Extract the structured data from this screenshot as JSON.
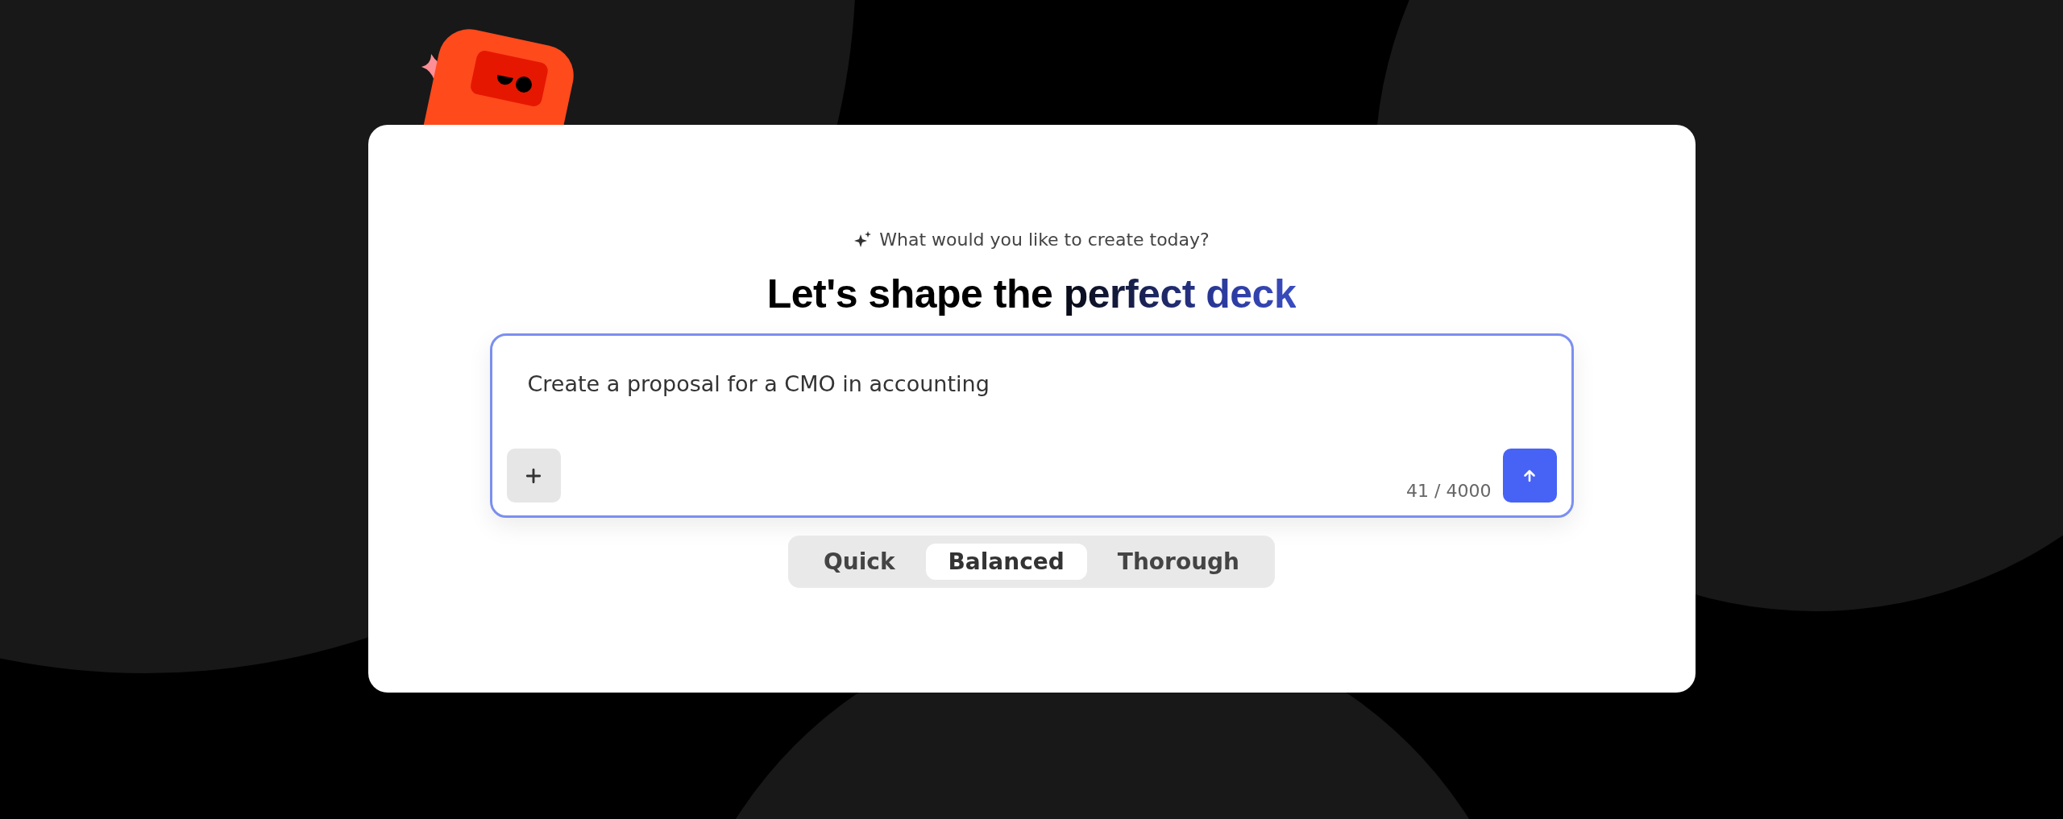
{
  "subtitle": "What would you like to create today?",
  "heading": "Let's shape the perfect deck",
  "prompt": {
    "value": "Create a proposal for a CMO in accounting",
    "counter": "41 / 4000"
  },
  "modes": [
    {
      "label": "Quick",
      "selected": false
    },
    {
      "label": "Balanced",
      "selected": true
    },
    {
      "label": "Thorough",
      "selected": false
    }
  ]
}
